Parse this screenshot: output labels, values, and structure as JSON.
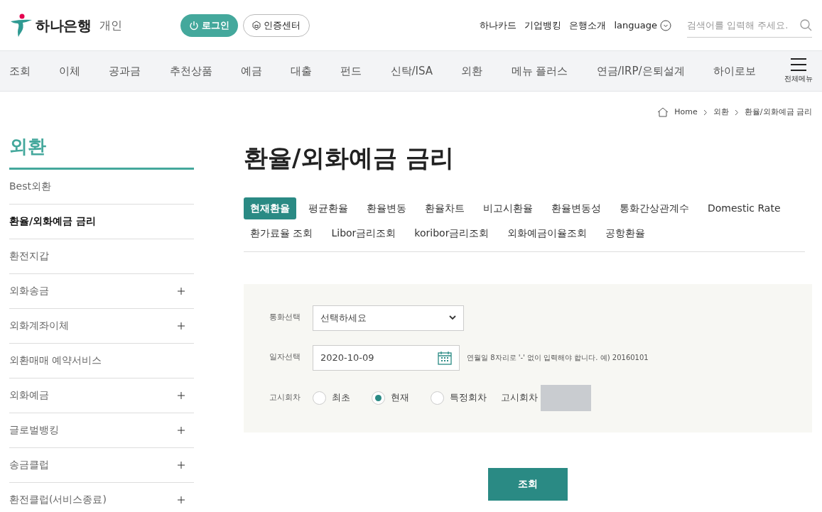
{
  "header": {
    "logo_text": "하나은행",
    "section": "개인",
    "login_button": "로그인",
    "cert_button": "인증센터",
    "links": [
      "하나카드",
      "기업뱅킹",
      "은행소개"
    ],
    "language": "language",
    "search": {
      "placeholder": "검색어를 입력해 주세요."
    }
  },
  "nav": {
    "items": [
      "조회",
      "이체",
      "공과금",
      "추천상품",
      "예금",
      "대출",
      "펀드",
      "신탁/ISA",
      "외환",
      "메뉴 플러스",
      "연금/IRP/은퇴설계",
      "하이로보"
    ],
    "all_menu": "전체메뉴"
  },
  "breadcrumb": [
    "Home",
    "외환",
    "환율/외화예금 금리"
  ],
  "sidebar": {
    "title": "외환",
    "items": [
      {
        "label": "Best외환",
        "selected": false,
        "expandable": false
      },
      {
        "label": "환율/외화예금 금리",
        "selected": true,
        "expandable": false
      },
      {
        "label": "환전지갑",
        "selected": false,
        "expandable": false
      },
      {
        "label": "외화송금",
        "selected": false,
        "expandable": true
      },
      {
        "label": "외화계좌이체",
        "selected": false,
        "expandable": true
      },
      {
        "label": "외환매매 예약서비스",
        "selected": false,
        "expandable": false
      },
      {
        "label": "외화예금",
        "selected": false,
        "expandable": true
      },
      {
        "label": "글로벌뱅킹",
        "selected": false,
        "expandable": true
      },
      {
        "label": "송금클럽",
        "selected": false,
        "expandable": true
      },
      {
        "label": "환전클럽(서비스종료)",
        "selected": false,
        "expandable": true
      }
    ]
  },
  "page_title": "환율/외화예금 금리",
  "tabs": [
    {
      "label": "현재환율",
      "selected": true
    },
    {
      "label": "평균환율",
      "selected": false
    },
    {
      "label": "환율변동",
      "selected": false
    },
    {
      "label": "환율차트",
      "selected": false
    },
    {
      "label": "비고시환율",
      "selected": false
    },
    {
      "label": "환율변동성",
      "selected": false
    },
    {
      "label": "통화간상관계수",
      "selected": false
    },
    {
      "label": "Domestic Rate",
      "selected": false
    },
    {
      "label": "환가료율 조회",
      "selected": false
    },
    {
      "label": "Libor금리조회",
      "selected": false
    },
    {
      "label": "koribor금리조회",
      "selected": false
    },
    {
      "label": "외화예금이율조회",
      "selected": false
    },
    {
      "label": "공항환율",
      "selected": false
    }
  ],
  "form": {
    "currency": {
      "label": "통화선택",
      "value": "선택하세요"
    },
    "date": {
      "label": "일자선택",
      "value": "2020-10-09",
      "hint": "연월일 8자리로 '-' 없이 입력해야 합니다. 예) 20160101"
    },
    "notice": {
      "label": "고시회차",
      "options": [
        {
          "label": "최초",
          "selected": false
        },
        {
          "label": "현재",
          "selected": true
        },
        {
          "label": "특정회차",
          "selected": false
        }
      ],
      "round_label": "고시회차"
    }
  },
  "submit_button": "조회"
}
